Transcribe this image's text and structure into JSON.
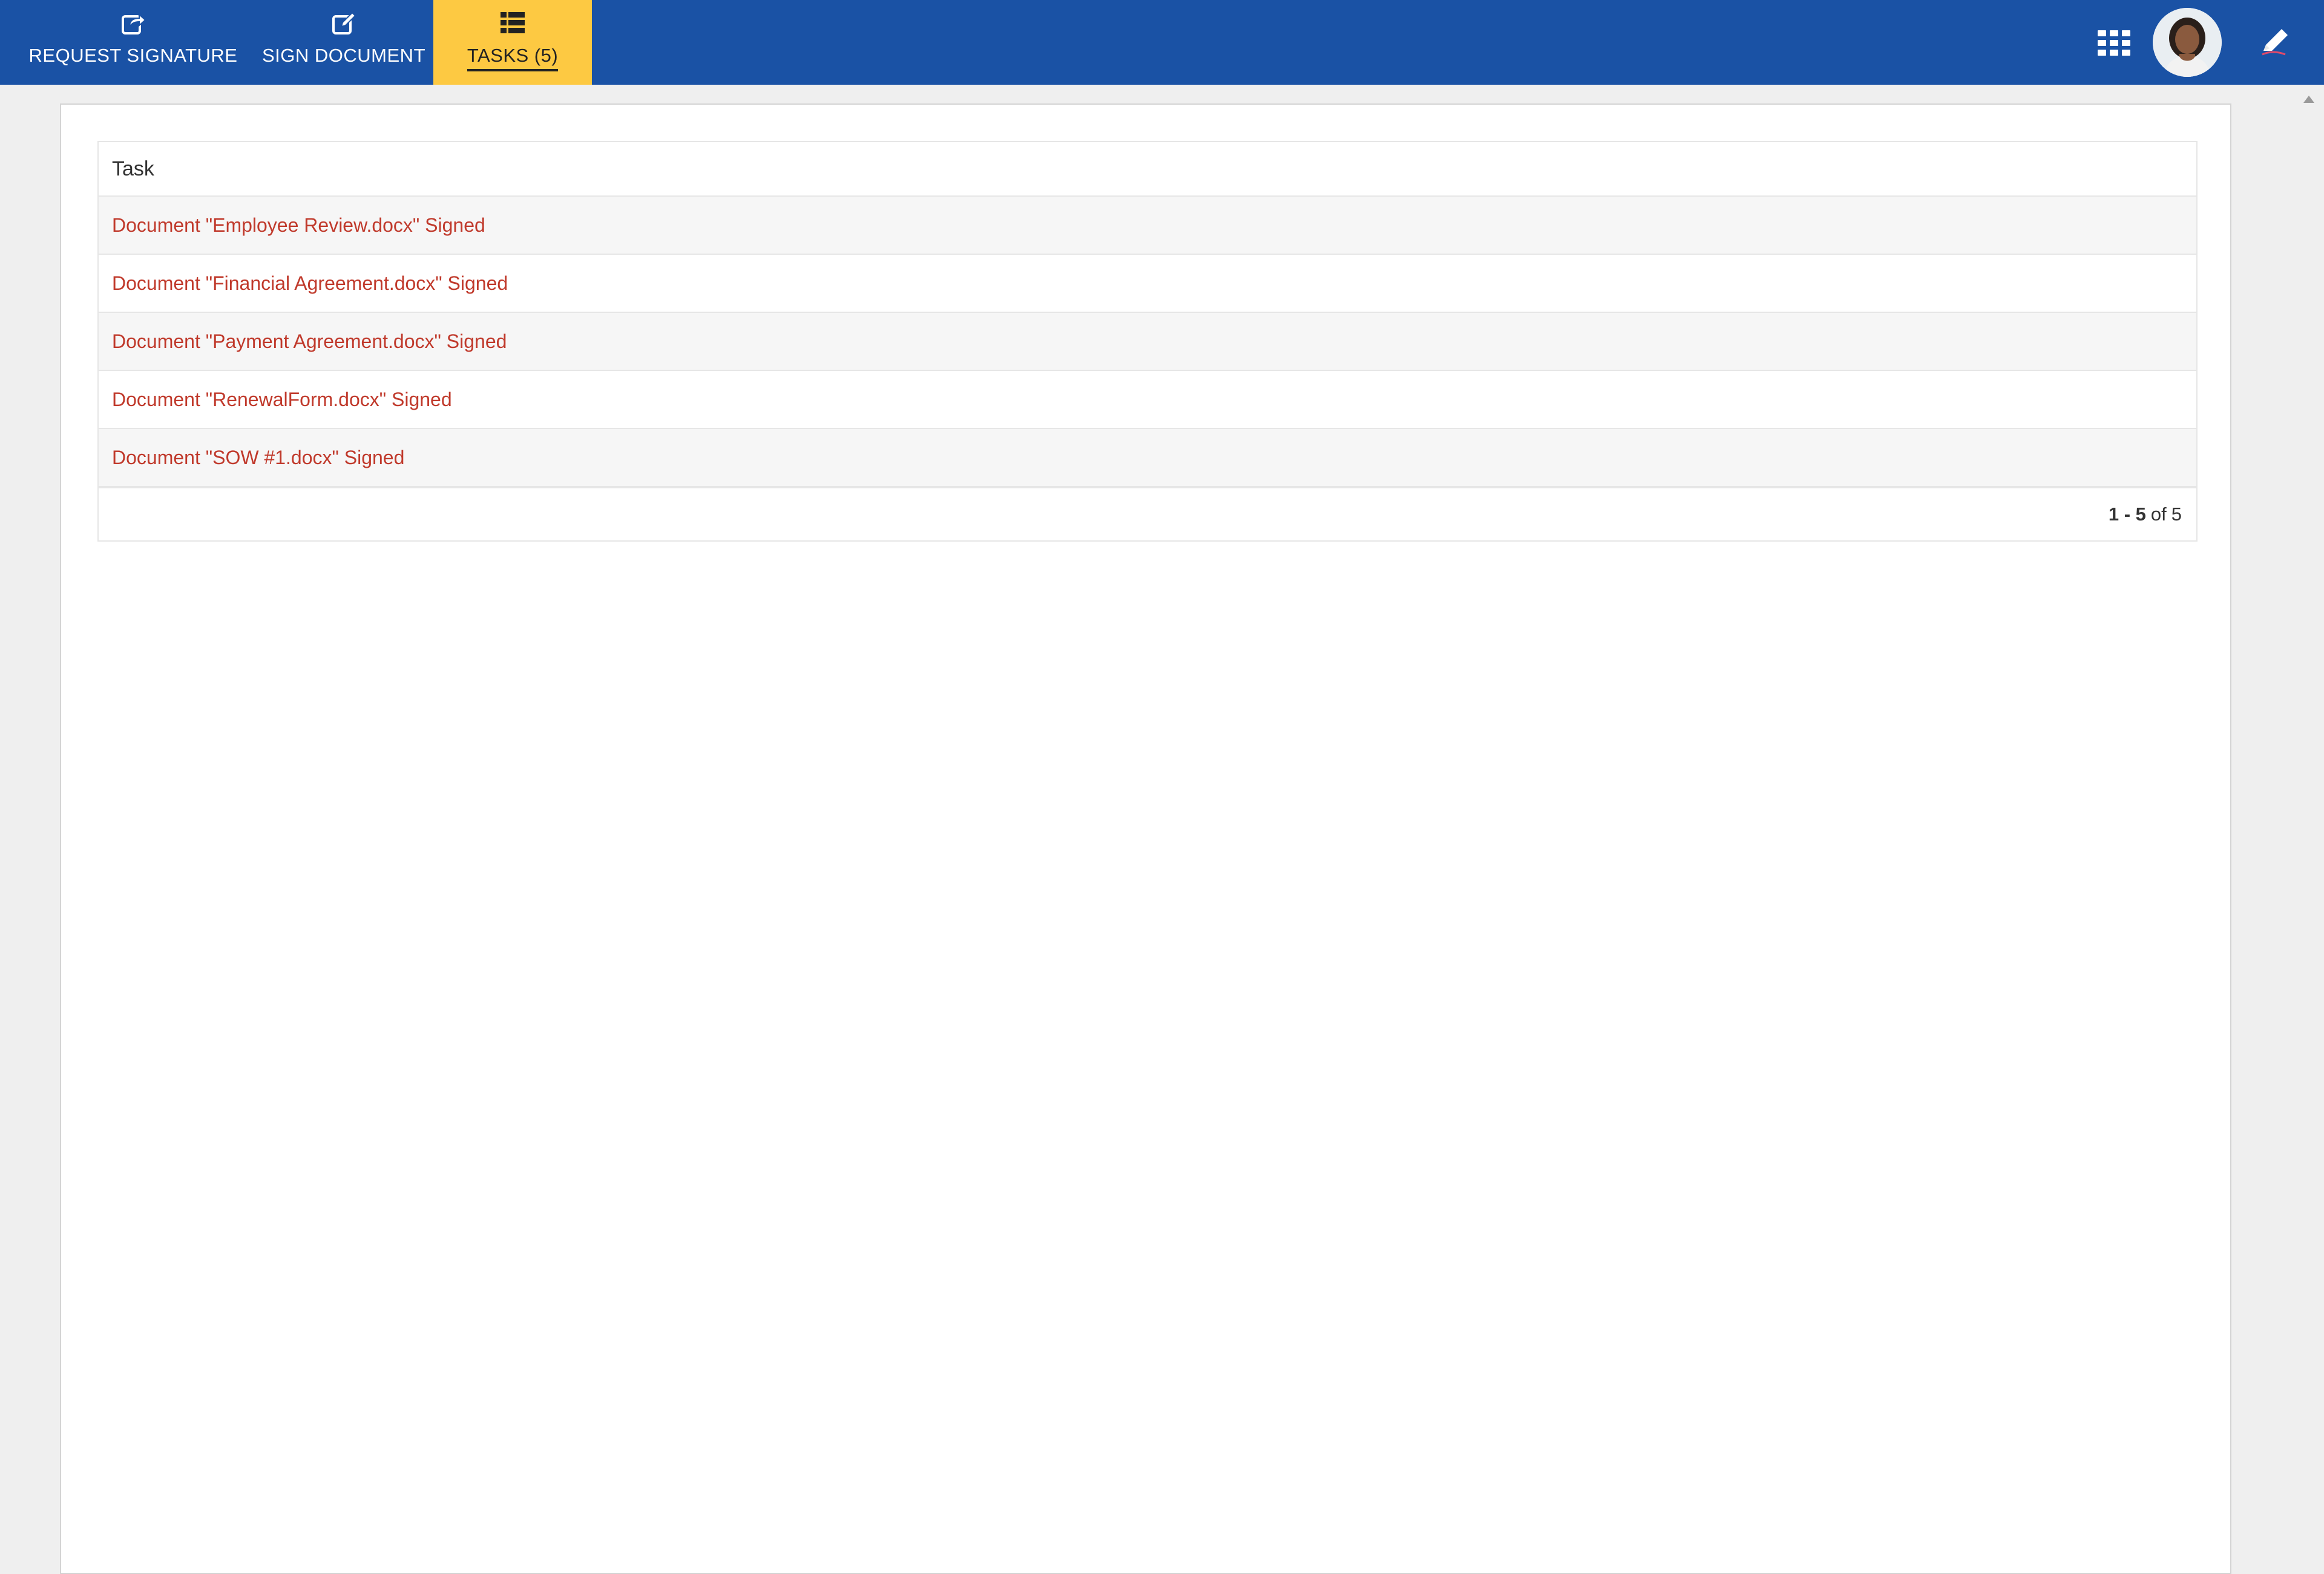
{
  "nav": {
    "tabs": [
      {
        "label": "REQUEST SIGNATURE",
        "icon": "share-icon"
      },
      {
        "label": "SIGN DOCUMENT",
        "icon": "edit-icon"
      },
      {
        "label": "TASKS (5)",
        "icon": "list-icon",
        "active": true
      }
    ]
  },
  "header_right": {
    "apps_icon": "grid-icon",
    "avatar": "user-avatar",
    "edit_icon": "pen-icon"
  },
  "tasks_table": {
    "header": "Task",
    "rows": [
      "Document \"Employee Review.docx\" Signed",
      "Document \"Financial Agreement.docx\" Signed",
      "Document \"Payment Agreement.docx\" Signed",
      "Document \"RenewalForm.docx\" Signed",
      "Document \"SOW #1.docx\" Signed"
    ],
    "pagination": {
      "range": "1 - 5",
      "of_label": "of",
      "total": "5"
    }
  },
  "colors": {
    "topbar": "#1a52a5",
    "active_tab": "#fdc942",
    "link": "#c0392b",
    "page_bg": "#efefef"
  }
}
